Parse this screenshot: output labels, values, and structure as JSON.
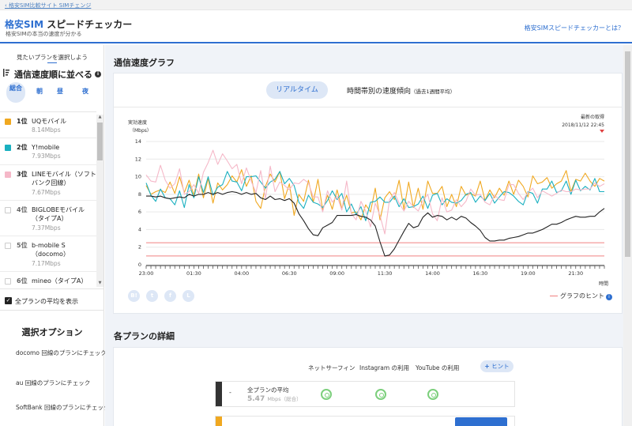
{
  "topbar": {
    "back_link": "格安SIM比較サイト SIMチェンジ"
  },
  "header": {
    "logo_blue": "格安SIM",
    "logo_black": "スピードチェッカー",
    "subtitle": "格安SIMの本当の速度が分かる",
    "about_link": "格安SIMスピードチェッカーとは？"
  },
  "sidebar": {
    "caption": "見たいプランを選択しよう",
    "sort_title": "通信速度順に並べる",
    "tabs": {
      "all": "総合",
      "morning": "朝",
      "noon": "昼",
      "night": "夜"
    },
    "plans": [
      {
        "rank": "1位",
        "name": "UQモバイル",
        "speed": "8.14Mbps",
        "color": "#f0a820",
        "checked": true
      },
      {
        "rank": "2位",
        "name": "Y!mobile",
        "speed": "7.93Mbps",
        "color": "#1ab0c0",
        "checked": true
      },
      {
        "rank": "3位",
        "name": "LINEモバイル（ソフトバンク回線）",
        "speed": "7.67Mbps",
        "color": "#f5b8c8",
        "checked": true
      },
      {
        "rank": "4位",
        "name": "BIGLOBEモバイル（タイプA）",
        "speed": "7.37Mbps",
        "color": "#cccccc",
        "checked": false
      },
      {
        "rank": "5位",
        "name": "b-mobile S（docomo）",
        "speed": "7.17Mbps",
        "color": "#cccccc",
        "checked": false
      },
      {
        "rank": "6位",
        "name": "mineo（タイプA）",
        "speed": "",
        "color": "#cccccc",
        "checked": false
      }
    ],
    "avg_label": "全プランの平均を表示",
    "options_title": "選択オプション",
    "options": [
      "docomo 回線のプランにチェック",
      "au 回線のプランにチェック",
      "SoftBank 回線のプランにチェック"
    ]
  },
  "graph_section": {
    "title": "通信速度グラフ",
    "tab_realtime": "リアルタイム",
    "tab_trend": "時間帯別の速度傾向",
    "tab_trend_note": "（過去1週間平均）",
    "share_icons": [
      "hatena-icon",
      "twitter-icon",
      "facebook-icon",
      "line-icon"
    ],
    "hint_link": "グラフのヒント"
  },
  "chart_data": {
    "type": "line",
    "ylabel": "実効速度",
    "yunit": "（Mbps）",
    "xlabel": "時間",
    "latest_label": "最新の取得",
    "latest_time": "2018/11/12 22:45",
    "ylim": [
      0,
      14
    ],
    "yticks": [
      0,
      2,
      4,
      6,
      8,
      10,
      12,
      14
    ],
    "xticks": [
      "23:00",
      "01:30",
      "04:00",
      "06:30",
      "09:00",
      "11:30",
      "14:00",
      "16:30",
      "19:00",
      "21:30"
    ],
    "x_start_hour": 23,
    "x_step_hours": 0.25,
    "reference_lines": [
      2.5,
      1.0
    ],
    "series": [
      {
        "name": "UQモバイル",
        "color": "#f0a820",
        "values": [
          9.0,
          8.0,
          8.3,
          8.5,
          8.2,
          9.4,
          8.1,
          10.0,
          8.2,
          9.6,
          7.9,
          10.3,
          7.6,
          9.8,
          7.0,
          9.3,
          8.5,
          9.1,
          10.1,
          9.4,
          10.8,
          8.9,
          10.1,
          7.2,
          6.4,
          8.9,
          10.3,
          9.4,
          10.6,
          7.5,
          9.2,
          5.6,
          8.0,
          7.2,
          9.6,
          7.1,
          9.7,
          6.2,
          7.9,
          6.3,
          8.5,
          6.4,
          7.9,
          5.9,
          6.0,
          5.1,
          6.8,
          6.0,
          8.7,
          5.1,
          7.6,
          8.3,
          7.4,
          9.6,
          6.3,
          9.4,
          6.5,
          8.7,
          6.3,
          9.5,
          8.1,
          8.1,
          8.9,
          6.6,
          8.0,
          6.6,
          8.9,
          7.9,
          8.1,
          7.8,
          9.5,
          7.3,
          8.5,
          7.6,
          8.7,
          7.9,
          9.5,
          8.0,
          9.6,
          8.9,
          7.7,
          10.1,
          9.2,
          9.4,
          9.9,
          8.7,
          9.2,
          9.5,
          10.7,
          8.3,
          9.7,
          9.5,
          10.4,
          9.5,
          8.9,
          9.8,
          9.5
        ]
      },
      {
        "name": "Y!mobile",
        "color": "#1ab0c0",
        "values": [
          9.3,
          7.9,
          7.2,
          8.6,
          7.6,
          7.5,
          6.8,
          8.4,
          6.5,
          9.1,
          7.6,
          10.0,
          8.2,
          10.0,
          7.9,
          8.8,
          9.1,
          10.6,
          9.5,
          9.4,
          8.4,
          10.0,
          10.0,
          10.1,
          9.4,
          8.7,
          9.4,
          9.7,
          10.6,
          9.2,
          9.8,
          9.0,
          7.1,
          6.4,
          7.9,
          7.1,
          6.9,
          6.5,
          7.3,
          8.4,
          7.4,
          8.1,
          6.0,
          6.9,
          5.7,
          6.6,
          5.0,
          7.1,
          7.2,
          7.7,
          7.1,
          7.1,
          7.8,
          6.6,
          7.5,
          6.5,
          6.6,
          6.9,
          7.8,
          6.4,
          7.9,
          8.1,
          6.8,
          7.5,
          7.1,
          7.0,
          7.3,
          8.0,
          8.2,
          7.1,
          7.8,
          7.3,
          8.1,
          7.0,
          7.7,
          8.3,
          8.2,
          7.8,
          7.2,
          6.8,
          8.3,
          8.1,
          7.0,
          8.6,
          8.6,
          9.5,
          8.2,
          8.4,
          9.5,
          8.0,
          9.6,
          8.4,
          8.9,
          8.5,
          9.8,
          8.3,
          8.3
        ]
      },
      {
        "name": "LINEモバイル（ソフトバンク回線）",
        "color": "#f5b8c8",
        "values": [
          10.2,
          9.5,
          9.4,
          11.3,
          9.6,
          8.7,
          9.2,
          10.9,
          8.0,
          8.3,
          9.1,
          8.1,
          10.5,
          11.6,
          13.0,
          11.4,
          12.6,
          11.8,
          10.9,
          11.4,
          9.2,
          11.0,
          9.5,
          8.2,
          10.7,
          7.5,
          11.2,
          8.3,
          9.4,
          9.0,
          8.5,
          9.3,
          9.2,
          9.7,
          9.3,
          7.7,
          7.7,
          6.0,
          8.4,
          7.1,
          7.8,
          6.2,
          9.5,
          5.8,
          5.1,
          7.2,
          6.1,
          4.3,
          7.0,
          5.6,
          3.5,
          7.4,
          8.2,
          7.0,
          6.1,
          7.2,
          6.6,
          6.1,
          7.3,
          8.0,
          5.8,
          5.0,
          7.6,
          6.0,
          6.2,
          7.4,
          6.6,
          7.2,
          8.6,
          7.9,
          8.0,
          7.1,
          6.8,
          7.9,
          7.4,
          7.3,
          9.1,
          9.1,
          8.1,
          7.4,
          8.2,
          8.7,
          7.6,
          8.4,
          8.1,
          7.8,
          8.1,
          8.5,
          8.3,
          8.3,
          8.6,
          8.5,
          8.6,
          8.6,
          9.3,
          8.9,
          9.2
        ]
      },
      {
        "name": "全プランの平均",
        "color": "#222222",
        "values": [
          7.8,
          7.8,
          7.7,
          7.8,
          7.6,
          7.5,
          7.6,
          7.7,
          7.6,
          8.0,
          7.8,
          8.0,
          8.0,
          8.2,
          8.0,
          8.2,
          8.0,
          8.2,
          8.3,
          8.2,
          8.0,
          8.2,
          8.0,
          8.1,
          7.6,
          7.4,
          7.8,
          7.4,
          7.5,
          7.3,
          7.5,
          7.0,
          5.8,
          5.0,
          4.1,
          3.4,
          3.3,
          4.2,
          4.5,
          4.8,
          5.6,
          5.6,
          5.6,
          5.6,
          5.7,
          5.5,
          5.4,
          5.1,
          4.4,
          2.6,
          1.0,
          1.1,
          1.8,
          2.8,
          3.8,
          4.7,
          4.2,
          4.4,
          5.4,
          5.9,
          5.4,
          5.6,
          5.5,
          5.1,
          5.4,
          5.1,
          5.5,
          5.3,
          4.8,
          4.4,
          3.9,
          3.1,
          2.7,
          2.7,
          2.8,
          2.8,
          3.0,
          3.1,
          3.2,
          3.4,
          3.6,
          3.6,
          3.8,
          4.0,
          4.3,
          4.6,
          4.6,
          4.8,
          5.1,
          5.3,
          5.5,
          5.4,
          5.4,
          5.5,
          5.5,
          6.0,
          6.4
        ]
      }
    ]
  },
  "details_section": {
    "title": "各プランの詳細",
    "columns": [
      "ネットサーフィン",
      "Instagram の利用",
      "YouTube の利用"
    ],
    "hint_button": "ヒント",
    "hint_plus": "+",
    "rows": [
      {
        "dash": "-",
        "name": "全プランの平均",
        "speed": "5.47",
        "unit": "Mbps（総合）"
      }
    ]
  }
}
